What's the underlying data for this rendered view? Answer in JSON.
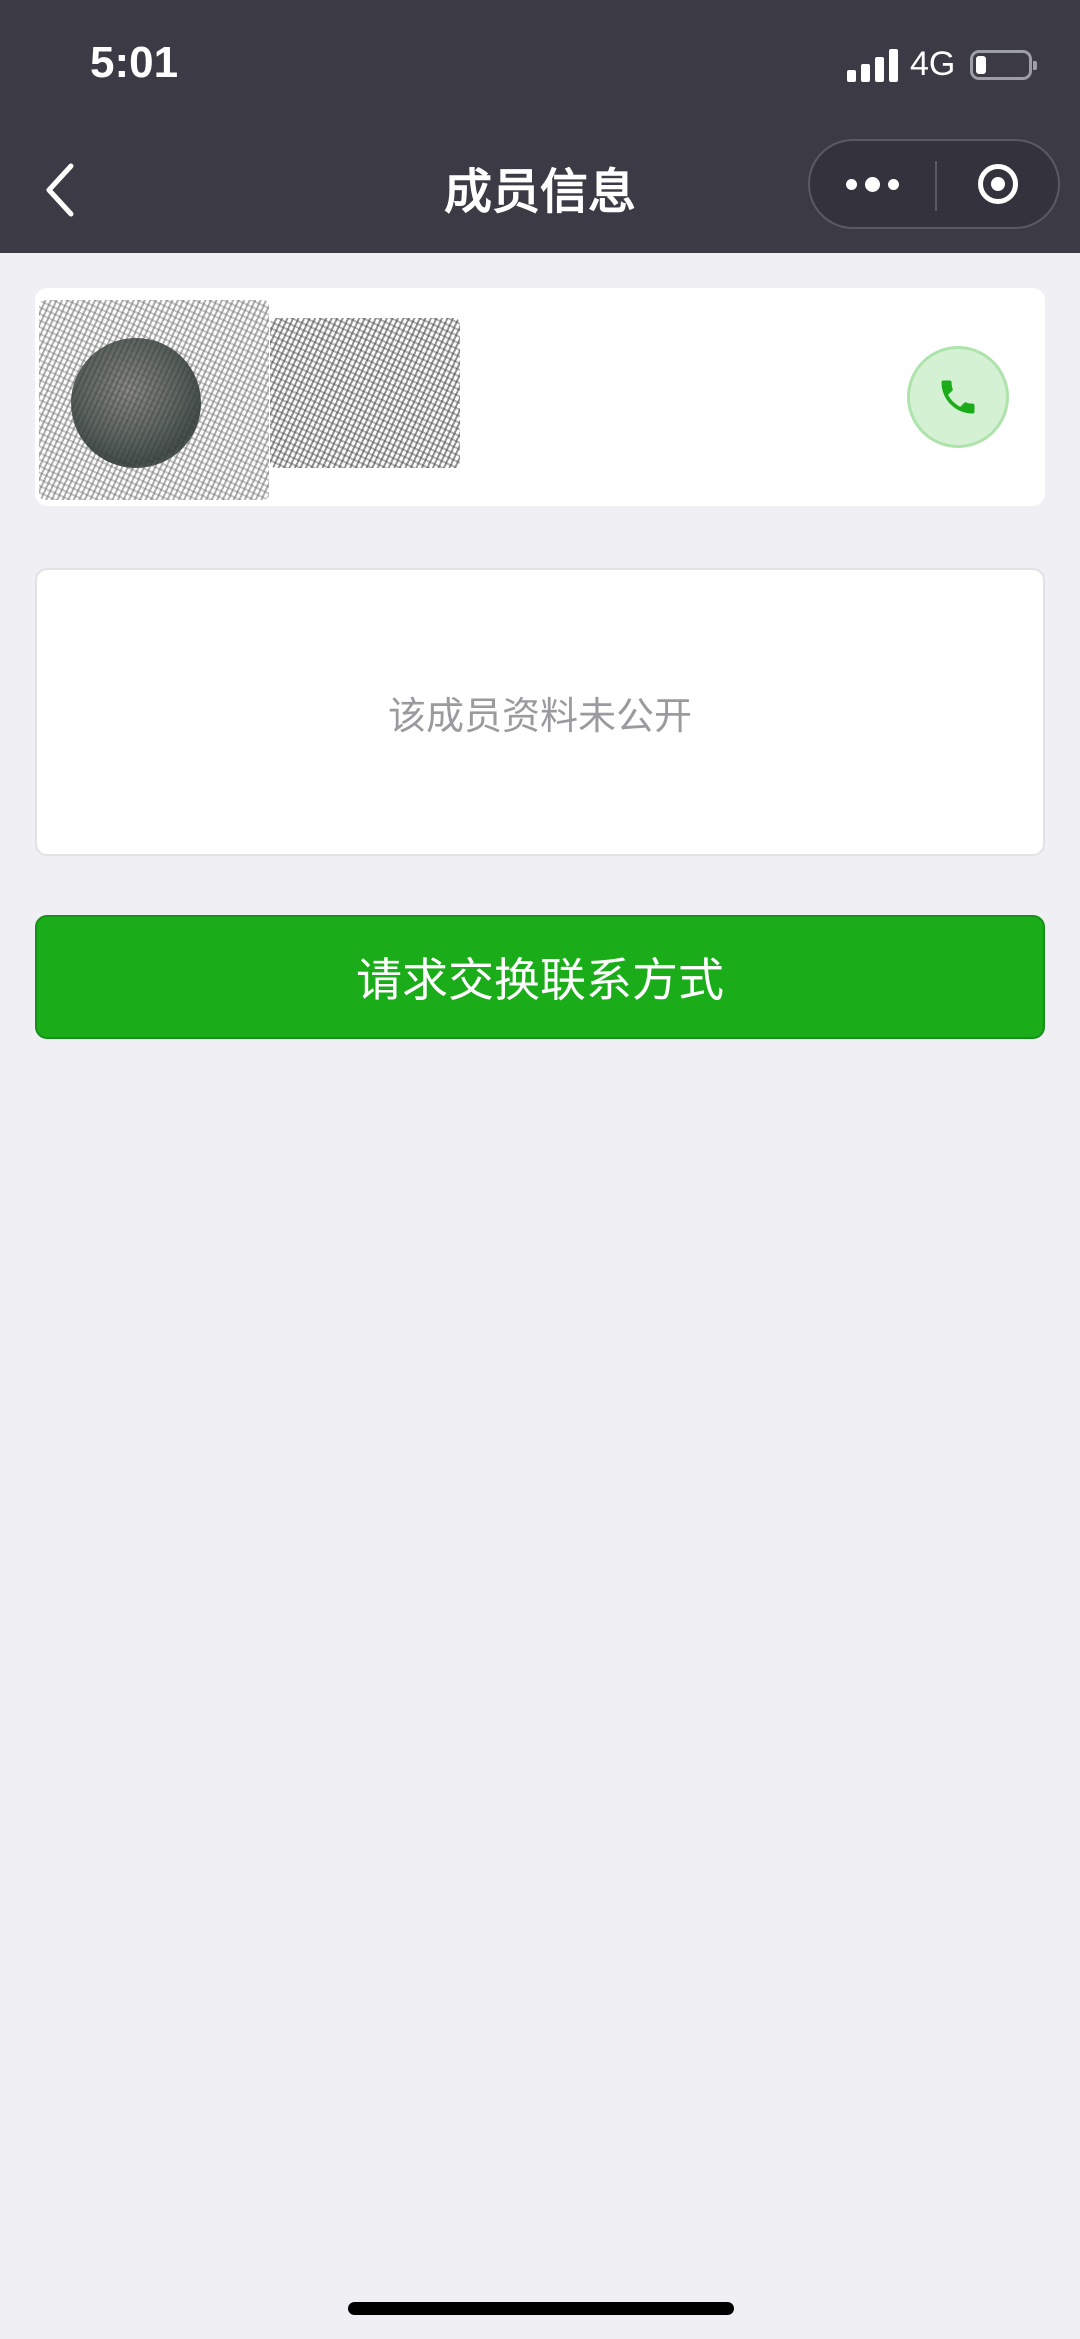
{
  "status_bar": {
    "time": "5:01",
    "network": "4G",
    "battery_level": 0.2
  },
  "nav": {
    "title": "成员信息",
    "back_icon": "chevron-left-icon",
    "more_icon": "more-dots-icon",
    "close_icon": "target-circle-icon"
  },
  "member": {
    "call_icon": "phone-icon",
    "call_color": "#1aad19"
  },
  "info": {
    "message": "该成员资料未公开"
  },
  "actions": {
    "exchange_label": "请求交换联系方式",
    "button_color": "#1aad19"
  }
}
